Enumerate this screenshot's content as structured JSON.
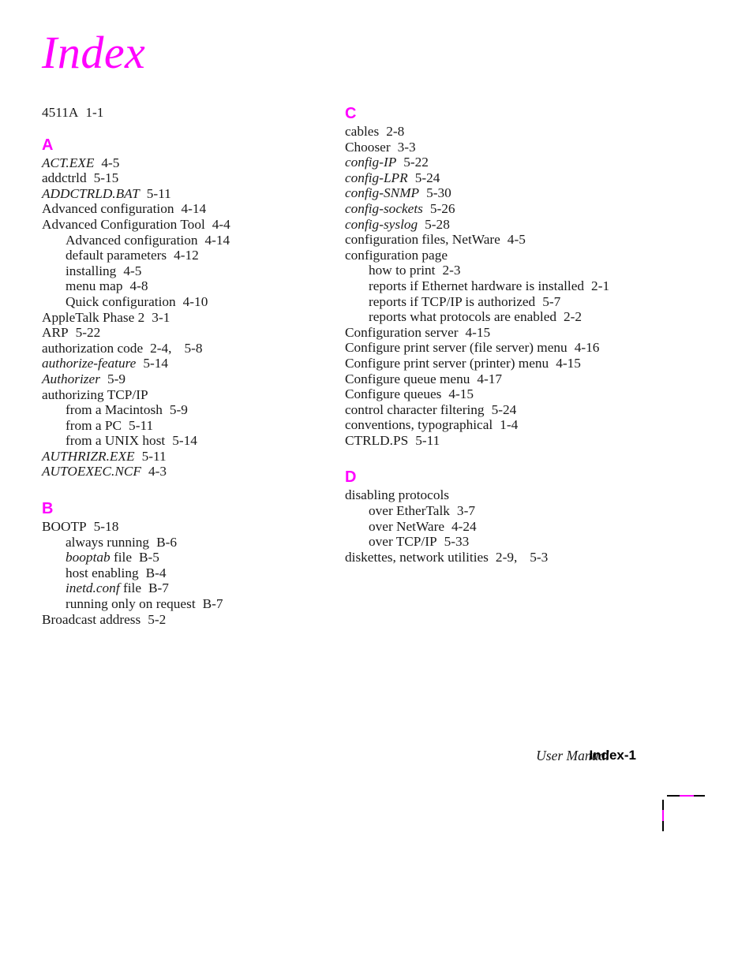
{
  "page": {
    "title": "Index",
    "title_color": "#ff00ff",
    "heading_color": "#ff00ff",
    "body_color": "#1a1a1a"
  },
  "preamble": [
    {
      "term": "4511A",
      "locator": "1-1",
      "level": 1,
      "italic": false
    }
  ],
  "groups": [
    {
      "letter": "A",
      "entries": [
        {
          "term": "ACT.EXE",
          "locator": "4-5",
          "level": 1,
          "italic": true
        },
        {
          "term": "addctrld",
          "locator": "5-15",
          "level": 1,
          "italic": false
        },
        {
          "term": "ADDCTRLD.BAT",
          "locator": "5-11",
          "level": 1,
          "italic": true
        },
        {
          "term": "Advanced configuration",
          "locator": "4-14",
          "level": 1,
          "italic": false
        },
        {
          "term": "Advanced Configuration Tool",
          "locator": "4-4",
          "level": 1,
          "italic": false
        },
        {
          "term": "Advanced configuration",
          "locator": "4-14",
          "level": 2,
          "italic": false
        },
        {
          "term": "default parameters",
          "locator": "4-12",
          "level": 2,
          "italic": false
        },
        {
          "term": "installing",
          "locator": "4-5",
          "level": 2,
          "italic": false
        },
        {
          "term": "menu map",
          "locator": "4-8",
          "level": 2,
          "italic": false
        },
        {
          "term": "Quick configuration",
          "locator": "4-10",
          "level": 2,
          "italic": false
        },
        {
          "term": "AppleTalk Phase 2",
          "locator": "3-1",
          "level": 1,
          "italic": false
        },
        {
          "term": "ARP",
          "locator": "5-22",
          "level": 1,
          "italic": false
        },
        {
          "term": "authorization code",
          "locator": "2-4,",
          "locator2": "5-8",
          "level": 1,
          "italic": false
        },
        {
          "term": "authorize-feature",
          "locator": "5-14",
          "level": 1,
          "italic": true
        },
        {
          "term": "Authorizer",
          "locator": "5-9",
          "level": 1,
          "italic": true
        },
        {
          "term": "authorizing TCP/IP",
          "locator": "",
          "level": 1,
          "italic": false
        },
        {
          "term": "from a Macintosh",
          "locator": "5-9",
          "level": 2,
          "italic": false
        },
        {
          "term": "from a PC",
          "locator": "5-11",
          "level": 2,
          "italic": false
        },
        {
          "term": "from a UNIX host",
          "locator": "5-14",
          "level": 2,
          "italic": false
        },
        {
          "term": "AUTHRIZR.EXE",
          "locator": "5-11",
          "level": 1,
          "italic": true
        },
        {
          "term": "AUTOEXEC.NCF",
          "locator": "4-3",
          "level": 1,
          "italic": true
        }
      ]
    },
    {
      "letter": "B",
      "entries": [
        {
          "term": "BOOTP",
          "locator": "5-18",
          "level": 1,
          "italic": false
        },
        {
          "term": "always running",
          "locator": "B-6",
          "level": 2,
          "italic": false
        },
        {
          "term_italic": "booptab",
          "term_roman": " file",
          "term": "booptab file",
          "locator": "B-5",
          "level": 2,
          "italic": false,
          "mixed": true
        },
        {
          "term": "host enabling",
          "locator": "B-4",
          "level": 2,
          "italic": false
        },
        {
          "term_italic": "inetd.conf",
          "term_roman": " file",
          "term": "inetd.conf file",
          "locator": "B-7",
          "level": 2,
          "italic": false,
          "mixed": true
        },
        {
          "term": "running only on request",
          "locator": "B-7",
          "level": 2,
          "italic": false
        },
        {
          "term": "Broadcast address",
          "locator": "5-2",
          "level": 1,
          "italic": false
        }
      ]
    }
  ],
  "groups_right": [
    {
      "letter": "C",
      "entries": [
        {
          "term": "cables",
          "locator": "2-8",
          "level": 1,
          "italic": false
        },
        {
          "term": "Chooser",
          "locator": "3-3",
          "level": 1,
          "italic": false
        },
        {
          "term": "config-IP",
          "locator": "5-22",
          "level": 1,
          "italic": true
        },
        {
          "term": "config-LPR",
          "locator": "5-24",
          "level": 1,
          "italic": true
        },
        {
          "term": "config-SNMP",
          "locator": "5-30",
          "level": 1,
          "italic": true
        },
        {
          "term": "config-sockets",
          "locator": "5-26",
          "level": 1,
          "italic": true
        },
        {
          "term": "config-syslog",
          "locator": "5-28",
          "level": 1,
          "italic": true
        },
        {
          "term": "configuration files, NetWare",
          "locator": "4-5",
          "level": 1,
          "italic": false
        },
        {
          "term": "configuration page",
          "locator": "",
          "level": 1,
          "italic": false
        },
        {
          "term": "how to print",
          "locator": "2-3",
          "level": 2,
          "italic": false
        },
        {
          "term": "reports if Ethernet hardware is installed",
          "locator": "2-1",
          "level": 2,
          "italic": false
        },
        {
          "term": "reports if TCP/IP is authorized",
          "locator": "5-7",
          "level": 2,
          "italic": false
        },
        {
          "term": "reports what protocols are enabled",
          "locator": "2-2",
          "level": 2,
          "italic": false
        },
        {
          "term": "Configuration server",
          "locator": "4-15",
          "level": 1,
          "italic": false
        },
        {
          "term": "Configure print server (file server) menu",
          "locator": "4-16",
          "level": 1,
          "italic": false
        },
        {
          "term": "Configure print server (printer) menu",
          "locator": "4-15",
          "level": 1,
          "italic": false
        },
        {
          "term": "Configure queue menu",
          "locator": "4-17",
          "level": 1,
          "italic": false
        },
        {
          "term": "Configure queues",
          "locator": "4-15",
          "level": 1,
          "italic": false
        },
        {
          "term": "control character filtering",
          "locator": "5-24",
          "level": 1,
          "italic": false
        },
        {
          "term": "conventions, typographical",
          "locator": "1-4",
          "level": 1,
          "italic": false
        },
        {
          "term": "CTRLD.PS",
          "locator": "5-11",
          "level": 1,
          "italic": false
        }
      ]
    },
    {
      "letter": "D",
      "entries": [
        {
          "term": "disabling protocols",
          "locator": "",
          "level": 1,
          "italic": false
        },
        {
          "term": "over EtherTalk",
          "locator": "3-7",
          "level": 2,
          "italic": false
        },
        {
          "term": "over NetWare",
          "locator": "4-24",
          "level": 2,
          "italic": false
        },
        {
          "term": "over TCP/IP",
          "locator": "5-33",
          "level": 2,
          "italic": false
        },
        {
          "term": "diskettes, network utilities",
          "locator": "2-9,",
          "locator2": "5-3",
          "level": 1,
          "italic": false
        }
      ]
    }
  ],
  "footer": {
    "manual_label": "User Manual",
    "page_number": "Index-1"
  },
  "crop_marks": {
    "accent_color": "#ff00ff",
    "line_color": "#000000"
  }
}
